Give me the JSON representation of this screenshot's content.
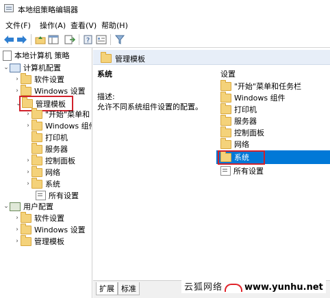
{
  "window": {
    "title": "本地组策略编辑器"
  },
  "menu": [
    "文件(F)",
    "操作(A)",
    "查看(V)",
    "帮助(H)"
  ],
  "toolbar": {
    "icons": [
      "back-arrow-icon",
      "forward-arrow-icon",
      "folder-up-icon",
      "show-hide-tree-icon",
      "export-list-icon",
      "help-icon",
      "properties-icon",
      "filter-icon"
    ]
  },
  "tree": {
    "root": "本地计算机 策略",
    "computer_config": "计算机配置",
    "software_settings": "软件设置",
    "windows_settings": "Windows 设置",
    "admin_templates": "管理模板",
    "admin_children": [
      "\"开始\"菜单和",
      "Windows 组件",
      "打印机",
      "服务器",
      "控制面板",
      "网络",
      "系统",
      "所有设置"
    ],
    "user_config": "用户配置",
    "user_software_settings": "软件设置",
    "user_windows_settings": "Windows 设置",
    "user_admin_templates": "管理模板"
  },
  "detail": {
    "header": "管理模板",
    "selected_title": "系统",
    "description_label": "描述:",
    "description_text": "允许不同系统组件设置的配置。",
    "settings_column": "设置",
    "items": [
      "\"开始\"菜单和任务栏",
      "Windows 组件",
      "打印机",
      "服务器",
      "控制面板",
      "网络",
      "系统",
      "所有设置"
    ],
    "selected_item": "系统"
  },
  "tabs": [
    "扩展",
    "标准"
  ],
  "watermark": {
    "cn": "云狐网络",
    "url": "www.yunhu.net"
  },
  "colors": {
    "selection": "#0078d7",
    "highlight_box": "#d0202a",
    "header_band": "#e7eef8"
  }
}
